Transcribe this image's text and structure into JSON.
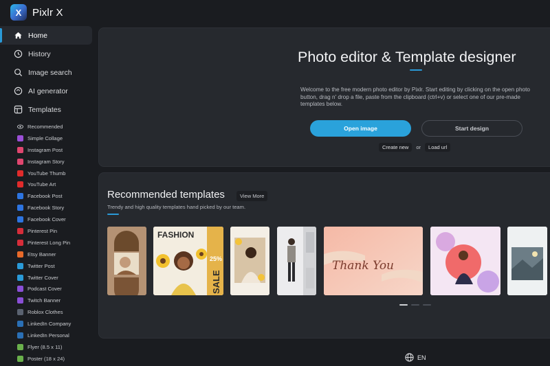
{
  "app": {
    "name": "Pixlr X",
    "logo_letter": "X"
  },
  "nav": [
    {
      "label": "Home",
      "icon": "home-icon",
      "active": true
    },
    {
      "label": "History",
      "icon": "history-icon"
    },
    {
      "label": "Image search",
      "icon": "search-icon"
    },
    {
      "label": "AI generator",
      "icon": "ai-icon"
    },
    {
      "label": "Templates",
      "icon": "templates-icon"
    }
  ],
  "templates": [
    {
      "label": "Recommended",
      "icon": "eye-icon",
      "color": "#1a1c20"
    },
    {
      "label": "Simple Collage",
      "icon": "collage-icon",
      "color": "#9b4fd6"
    },
    {
      "label": "Instagram Post",
      "icon": "instagram-icon",
      "color": "#e0466f"
    },
    {
      "label": "Instagram Story",
      "icon": "instagram-icon",
      "color": "#e0466f"
    },
    {
      "label": "YouTube Thumb",
      "icon": "youtube-icon",
      "color": "#e02b2b"
    },
    {
      "label": "YouTube Art",
      "icon": "youtube-icon",
      "color": "#e02b2b"
    },
    {
      "label": "Facebook Post",
      "icon": "facebook-icon",
      "color": "#2d74e0"
    },
    {
      "label": "Facebook Story",
      "icon": "facebook-icon",
      "color": "#2d74e0"
    },
    {
      "label": "Facebook Cover",
      "icon": "facebook-icon",
      "color": "#2d74e0"
    },
    {
      "label": "Pinterest Pin",
      "icon": "pinterest-icon",
      "color": "#d62d3a"
    },
    {
      "label": "Pinterest Long Pin",
      "icon": "pinterest-icon",
      "color": "#d62d3a"
    },
    {
      "label": "Etsy Banner",
      "icon": "etsy-icon",
      "color": "#e86a2a"
    },
    {
      "label": "Twitter Post",
      "icon": "twitter-icon",
      "color": "#2a9ad8"
    },
    {
      "label": "Twitter Cover",
      "icon": "twitter-icon",
      "color": "#2a9ad8"
    },
    {
      "label": "Podcast Cover",
      "icon": "podcast-icon",
      "color": "#8a4fd6"
    },
    {
      "label": "Twitch Banner",
      "icon": "twitch-icon",
      "color": "#8a4fd6"
    },
    {
      "label": "Roblox Clothes",
      "icon": "roblox-icon",
      "color": "#5a6270"
    },
    {
      "label": "LinkedIn Company",
      "icon": "linkedin-icon",
      "color": "#2a6fb5"
    },
    {
      "label": "LinkedIn Personal",
      "icon": "linkedin-icon",
      "color": "#2a6fb5"
    },
    {
      "label": "Flyer (8.5 x 11)",
      "icon": "flyer-icon",
      "color": "#6ab04c"
    },
    {
      "label": "Poster (18 x 24)",
      "icon": "poster-icon",
      "color": "#6ab04c"
    }
  ],
  "hero": {
    "title": "Photo editor & Template designer",
    "description": "Welcome to the free modern photo editor by Pixlr. Start editing by clicking on the open photo button, drag n' drop a file, paste from the clipboard (ctrl+v) or select one of our pre-made templates below.",
    "open_button": "Open image",
    "design_button": "Start design",
    "create_new": "Create new",
    "or": "or",
    "load_url": "Load url"
  },
  "recommended": {
    "title": "Recommended templates",
    "more_button": "View More",
    "subtitle": "Trendy and high quality templates hand picked by our team.",
    "cards": [
      {
        "name": "arches-portrait"
      },
      {
        "name": "fashion-sale",
        "text_top": "FASHION",
        "text_side": "SALE",
        "text_pct": "25%"
      },
      {
        "name": "sunflower-photo"
      },
      {
        "name": "street-collage"
      },
      {
        "name": "thank-you-card",
        "text": "Thank You"
      },
      {
        "name": "new-collection"
      },
      {
        "name": "landscape-post"
      }
    ]
  },
  "footer": {
    "language": "EN"
  },
  "colors": {
    "accent": "#2aa2db",
    "background": "#1a1c20",
    "panel": "#26292e"
  }
}
